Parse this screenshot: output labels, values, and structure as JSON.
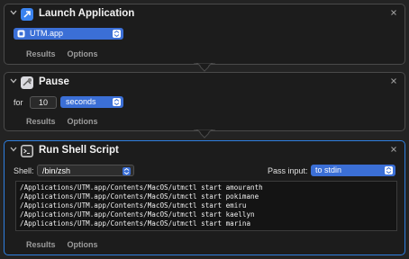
{
  "launch": {
    "title": "Launch Application",
    "app": "UTM.app",
    "tabs": [
      "Results",
      "Options"
    ]
  },
  "pause": {
    "title": "Pause",
    "for_label": "for",
    "duration": "10",
    "unit": "seconds",
    "tabs": [
      "Results",
      "Options"
    ]
  },
  "shell": {
    "title": "Run Shell Script",
    "shell_label": "Shell:",
    "shell": "/bin/zsh",
    "pass_input_label": "Pass input:",
    "pass_input": "to stdin",
    "script_lines": [
      "/Applications/UTM.app/Contents/MacOS/utmctl start amouranth",
      "/Applications/UTM.app/Contents/MacOS/utmctl start pokimane",
      "/Applications/UTM.app/Contents/MacOS/utmctl start emiru",
      "/Applications/UTM.app/Contents/MacOS/utmctl start kaellyn",
      "/Applications/UTM.app/Contents/MacOS/utmctl start marina"
    ],
    "tabs": [
      "Results",
      "Options"
    ]
  },
  "colors": {
    "accent": "#2f7fe0",
    "popup": "#3b6fd6",
    "background": "#1c1c1c"
  },
  "icons": {
    "launch": "launch-application-icon",
    "pause": "pause-icon",
    "shell": "terminal-icon",
    "chevron": "chevron-down-icon",
    "close": "close-icon"
  }
}
